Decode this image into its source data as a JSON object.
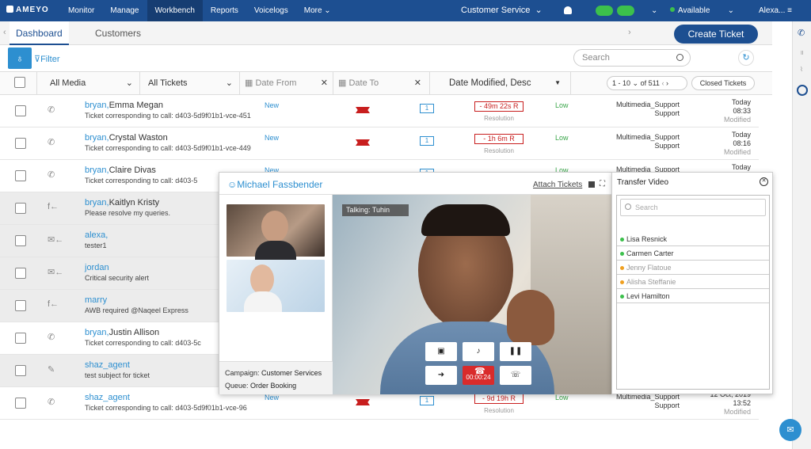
{
  "app": {
    "logo": "AMEYO",
    "nav": [
      "Monitor",
      "Manage",
      "Workbench",
      "Reports",
      "Voicelogs",
      "More"
    ],
    "active_nav": "Workbench",
    "campaign": "Customer Service",
    "status": "Available",
    "user": "Alexa...",
    "status_color": "#3cc04c",
    "brand_color": "#1d4f91"
  },
  "tabs": [
    "Dashboard",
    "Customers"
  ],
  "create_ticket": "Create Ticket",
  "filter": {
    "label": "Filter",
    "search_placeholder": "Search",
    "media": "All Media",
    "tickets": "All Tickets",
    "date_from": "Date From",
    "date_to": "Date To",
    "sort": "Date Modified, Desc",
    "pagination": "1 - 10",
    "of": "of 511",
    "closed": "Closed Tickets"
  },
  "rows": [
    {
      "agent": "bryan,",
      "customer": "Emma Megan",
      "subject": "Ticket corresponding to call: d403-5d9f01b1-vce-451",
      "status": "New",
      "count": "1",
      "sla": "- 49m 22s R",
      "res": "Resolution",
      "priority": "Low",
      "queue1": "Multimedia_Support",
      "queue2": "Support",
      "date1": "Today",
      "date2": "08:33",
      "mod": "Modified",
      "channel": "call-icon",
      "glyph": "✆"
    },
    {
      "agent": "bryan,",
      "customer": "Crystal Waston",
      "subject": "Ticket corresponding to call: d403-5d9f01b1-vce-449",
      "status": "New",
      "count": "1",
      "sla": "- 1h 6m R",
      "res": "Resolution",
      "priority": "Low",
      "queue1": "Multimedia_Support",
      "queue2": "Support",
      "date1": "Today",
      "date2": "08:16",
      "mod": "Modified",
      "channel": "call-icon",
      "glyph": "✆"
    },
    {
      "agent": "bryan,",
      "customer": "Claire Divas",
      "subject": "Ticket corresponding to call: d403-5",
      "status": "New",
      "count": "1",
      "sla": "",
      "res": "",
      "priority": "Low",
      "queue1": "Multimedia_Support",
      "queue2": "",
      "date1": "Today",
      "date2": "",
      "mod": "",
      "channel": "call-icon",
      "glyph": "✆"
    },
    {
      "agent": "bryan,",
      "customer": "Kaitlyn Kristy",
      "subject": "Please resolve my queries.",
      "status": "",
      "count": "",
      "sla": "",
      "res": "",
      "priority": "",
      "queue1": "",
      "queue2": "",
      "date1": "",
      "date2": "",
      "mod": "",
      "channel": "facebook-icon",
      "glyph": "f←"
    },
    {
      "agent": "alexa,",
      "customer": "",
      "subject": "tester1",
      "status": "",
      "count": "",
      "sla": "",
      "res": "",
      "priority": "",
      "queue1": "",
      "queue2": "",
      "date1": "",
      "date2": "",
      "mod": "",
      "channel": "email-icon",
      "glyph": "✉←"
    },
    {
      "agent": "jordan",
      "customer": "",
      "subject": "Critical security alert",
      "status": "",
      "count": "",
      "sla": "",
      "res": "",
      "priority": "",
      "queue1": "",
      "queue2": "",
      "date1": "",
      "date2": "",
      "mod": "",
      "channel": "email-icon",
      "glyph": "✉←"
    },
    {
      "agent": "marry",
      "customer": "",
      "subject": "AWB required @Naqeel Express",
      "status": "",
      "count": "",
      "sla": "",
      "res": "",
      "priority": "",
      "queue1": "",
      "queue2": "",
      "date1": "",
      "date2": "",
      "mod": "",
      "channel": "facebook-icon",
      "glyph": "f←"
    },
    {
      "agent": "bryan,",
      "customer": "Justin Allison",
      "subject": "Ticket corresponding to call: d403-5c",
      "status": "",
      "count": "",
      "sla": "",
      "res": "",
      "priority": "",
      "queue1": "",
      "queue2": "",
      "date1": "",
      "date2": "",
      "mod": "",
      "channel": "call-icon",
      "glyph": "✆"
    },
    {
      "agent": "shaz_agent",
      "customer": "",
      "subject": "test subject for ticket",
      "status": "",
      "count": "",
      "sla": "",
      "res": "",
      "priority": "",
      "queue1": "",
      "queue2": "",
      "date1": "",
      "date2": "",
      "mod": "",
      "channel": "note-icon",
      "glyph": "✎"
    },
    {
      "agent": "shaz_agent",
      "customer": "",
      "subject": "Ticket corresponding to call: d403-5d9f01b1-vce-96",
      "status": "New",
      "count": "1",
      "sla": "- 9d 19h R",
      "res": "Resolution",
      "priority": "Low",
      "queue1": "Multimedia_Support",
      "queue2": "Support",
      "date1": "12 Oct, 2019",
      "date2": "13:52",
      "mod": "Modified",
      "channel": "call-icon",
      "glyph": "✆"
    }
  ],
  "popup": {
    "caller": "Michael Fassbender",
    "attach": "Attach Tickets",
    "talking": "Talking: Tuhin",
    "campaign_label": "Campaign:",
    "campaign": "Customer Services",
    "queue_label": "Queue:",
    "queue": "Order Booking",
    "timer": "00:00:24"
  },
  "transfer": {
    "title": "Transfer Video",
    "search_placeholder": "Search",
    "agents": [
      {
        "name": "Lisa Resnick",
        "color": "#3cc04c"
      },
      {
        "name": "Carmen Carter",
        "color": "#3cc04c"
      },
      {
        "name": "Jenny Flatoue",
        "color": "#f0a020"
      },
      {
        "name": "Alisha Steffanie",
        "color": "#f0a020"
      },
      {
        "name": "Levi Hamilton",
        "color": "#3cc04c"
      }
    ]
  }
}
